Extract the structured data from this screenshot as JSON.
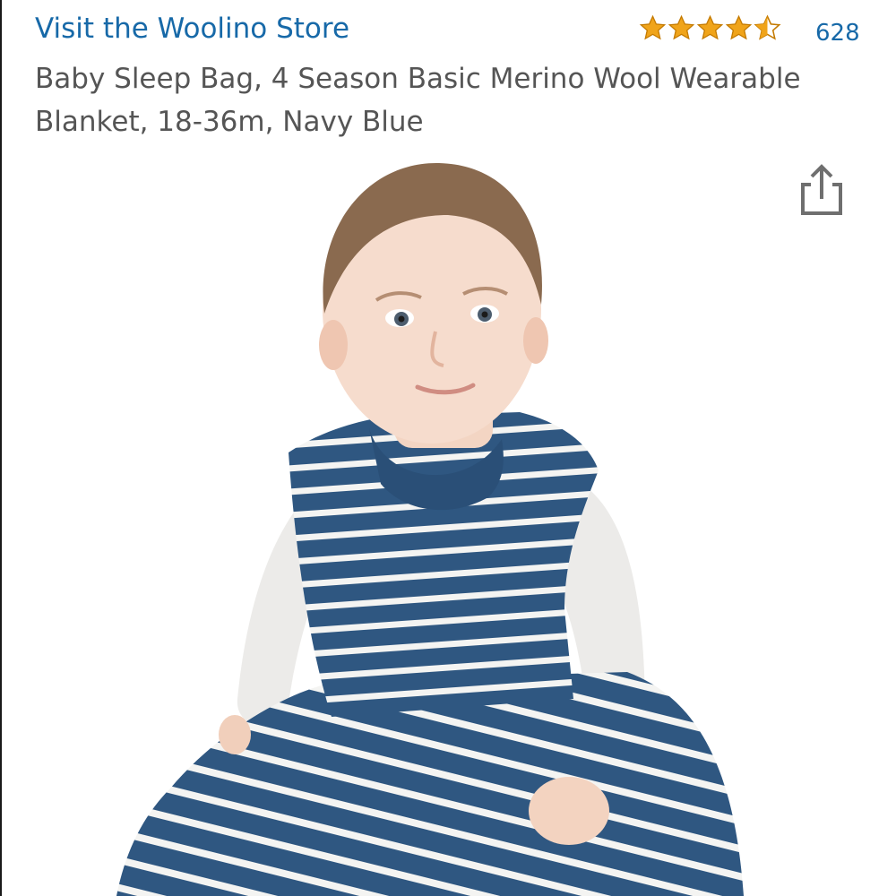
{
  "header": {
    "store_link": "Visit the Woolino Store",
    "rating": 4.5,
    "review_count": "628"
  },
  "product": {
    "title": "Baby Sleep Bag, 4 Season Basic Merino Wool Wearable Blanket, 18-36m, Navy Blue"
  },
  "icons": {
    "share": "share-icon",
    "star": "star-icon"
  },
  "colors": {
    "link": "#1769a8",
    "star": "#f0a41a",
    "star_outline": "#c47a00",
    "title_text": "#555555",
    "stripe_navy": "#2f5781"
  }
}
